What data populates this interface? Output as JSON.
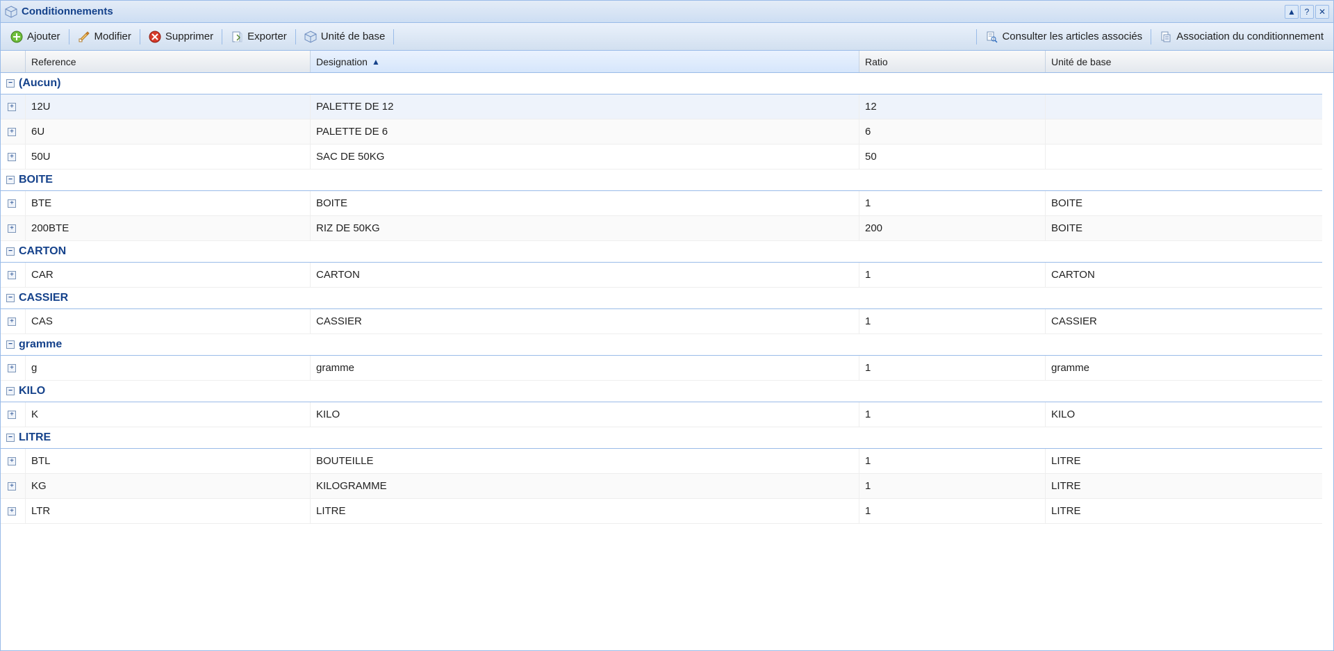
{
  "panel": {
    "title": "Conditionnements"
  },
  "toolbar": {
    "add": "Ajouter",
    "edit": "Modifier",
    "delete": "Supprimer",
    "export": "Exporter",
    "base_unit": "Unité de base",
    "consult_articles": "Consulter les articles associés",
    "assoc_cond": "Association du conditionnement"
  },
  "columns": {
    "reference": "Reference",
    "designation": "Designation",
    "ratio": "Ratio",
    "unite": "Unité de base"
  },
  "groups": [
    {
      "name": "(Aucun)",
      "rows": [
        {
          "reference": "12U",
          "designation": "PALETTE DE 12",
          "ratio": "12",
          "unite": ""
        },
        {
          "reference": "6U",
          "designation": "PALETTE DE 6",
          "ratio": "6",
          "unite": ""
        },
        {
          "reference": "50U",
          "designation": "SAC DE 50KG",
          "ratio": "50",
          "unite": ""
        }
      ]
    },
    {
      "name": "BOITE",
      "rows": [
        {
          "reference": "BTE",
          "designation": "BOITE",
          "ratio": "1",
          "unite": "BOITE"
        },
        {
          "reference": "200BTE",
          "designation": "RIZ DE 50KG",
          "ratio": "200",
          "unite": "BOITE"
        }
      ]
    },
    {
      "name": "CARTON",
      "rows": [
        {
          "reference": "CAR",
          "designation": "CARTON",
          "ratio": "1",
          "unite": "CARTON"
        }
      ]
    },
    {
      "name": "CASSIER",
      "rows": [
        {
          "reference": "CAS",
          "designation": "CASSIER",
          "ratio": "1",
          "unite": "CASSIER"
        }
      ]
    },
    {
      "name": "gramme",
      "rows": [
        {
          "reference": "g",
          "designation": "gramme",
          "ratio": "1",
          "unite": "gramme"
        }
      ]
    },
    {
      "name": "KILO",
      "rows": [
        {
          "reference": "K",
          "designation": "KILO",
          "ratio": "1",
          "unite": "KILO"
        }
      ]
    },
    {
      "name": "LITRE",
      "rows": [
        {
          "reference": "BTL",
          "designation": "BOUTEILLE",
          "ratio": "1",
          "unite": "LITRE"
        },
        {
          "reference": "KG",
          "designation": "KILOGRAMME",
          "ratio": "1",
          "unite": "LITRE"
        },
        {
          "reference": "LTR",
          "designation": "LITRE",
          "ratio": "1",
          "unite": "LITRE"
        }
      ]
    }
  ],
  "glyphs": {
    "minus": "−",
    "plus": "+",
    "sort_asc": "▲",
    "collapse": "▲",
    "help": "?",
    "close": "✕"
  }
}
